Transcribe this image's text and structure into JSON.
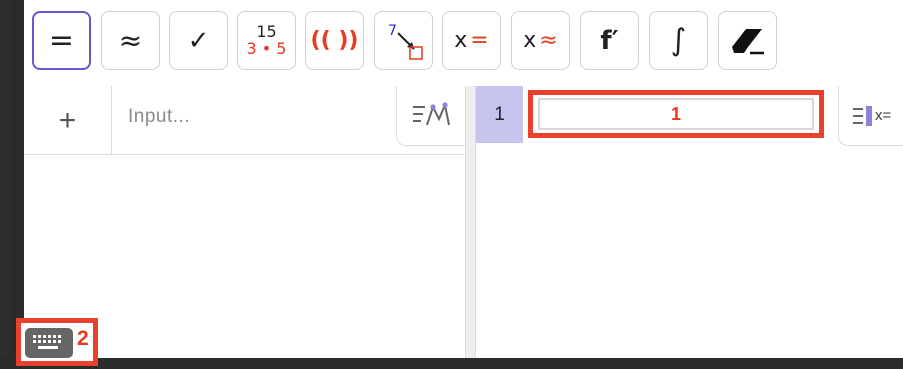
{
  "toolbar": {
    "buttons": [
      {
        "name": "evaluate",
        "icon": "equals-icon",
        "label": "="
      },
      {
        "name": "numeric",
        "icon": "approx-icon",
        "label": "≈"
      },
      {
        "name": "keep-input",
        "icon": "check-icon",
        "label": "✓"
      },
      {
        "name": "factor",
        "icon": "factor-icon",
        "top": "15",
        "bottom": "3 • 5"
      },
      {
        "name": "expand",
        "icon": "expand-icon",
        "label": "(( ))"
      },
      {
        "name": "substitute",
        "icon": "substitute-icon",
        "label": "7"
      },
      {
        "name": "solve",
        "icon": "solve-icon",
        "label": "x",
        "sign": "="
      },
      {
        "name": "solve-numerically",
        "icon": "solve-numeric-icon",
        "label": "x",
        "sign": "≈"
      },
      {
        "name": "derivative",
        "icon": "derivative-icon",
        "label": "f′"
      },
      {
        "name": "integral",
        "icon": "integral-icon",
        "label": "∫"
      },
      {
        "name": "delete",
        "icon": "eraser-icon"
      }
    ]
  },
  "algebra": {
    "add_label": "+",
    "input_placeholder": "Input..."
  },
  "spreadsheet": {
    "row_number": "1",
    "cell_value": "1",
    "style_label": "x="
  },
  "annotations": {
    "cell_marker": "1",
    "keyboard_marker": "2"
  },
  "colors": {
    "accent": "#6557d2",
    "highlight": "#e8422f",
    "row_header": "#c5c4ef"
  }
}
